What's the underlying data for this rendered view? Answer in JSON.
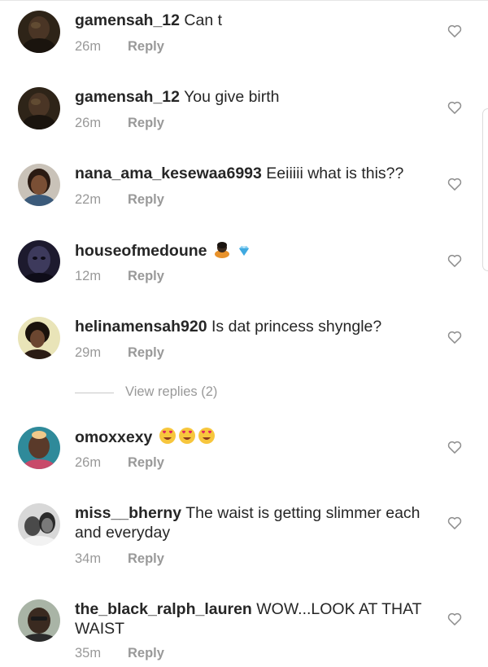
{
  "reply_label": "Reply",
  "comments": [
    {
      "username": "gamensah_12",
      "text": "Can t",
      "time": "26m"
    },
    {
      "username": "gamensah_12",
      "text": "You give birth",
      "time": "26m"
    },
    {
      "username": "nana_ama_kesewaa6993",
      "text": "Eeiiiii what is this??",
      "time": "22m"
    },
    {
      "username": "houseofmedoune",
      "text": "",
      "time": "12m",
      "emojis": [
        "person-bowing-emoji",
        "gem-emoji"
      ]
    },
    {
      "username": "helinamensah920",
      "text": "Is dat princess shyngle?",
      "time": "29m"
    },
    {
      "username": "omoxxexy",
      "text": "",
      "time": "26m",
      "emojis": [
        "heart-eyes-emoji",
        "heart-eyes-emoji",
        "heart-eyes-emoji"
      ]
    },
    {
      "username": "miss__bherny",
      "text": "The waist is getting slimmer each and everyday",
      "time": "34m"
    },
    {
      "username": "the_black_ralph_lauren",
      "text": "WOW...LOOK AT THAT WAIST",
      "time": "35m"
    }
  ],
  "view_replies": "View replies (2)",
  "colors": {
    "text": "#262626",
    "muted": "#999999",
    "divider": "#c7c7c7"
  }
}
